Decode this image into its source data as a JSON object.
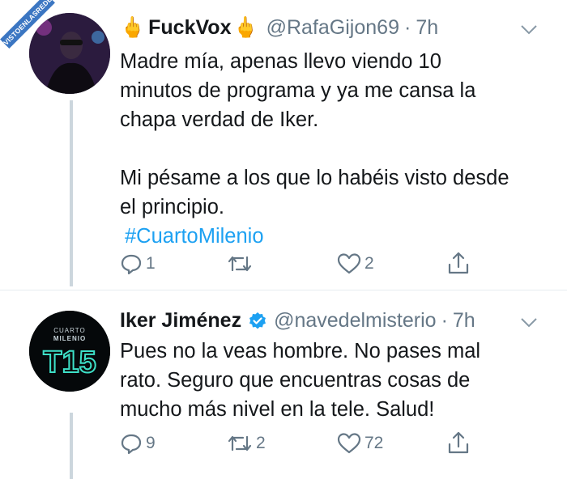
{
  "watermark": "VISTOENLASREDES",
  "tweets": [
    {
      "name": "FuckVox",
      "emoji_left": "🖕",
      "emoji_right": "🖕",
      "handle": "@RafaGijon69",
      "sep": "·",
      "time": "7h",
      "paragraphs": [
        "Madre mía, apenas llevo viendo 10 minutos de programa y ya me cansa la chapa verdad de Iker.",
        "Mi pésame a los que lo habéis visto desde el principio."
      ],
      "hashtag": "#CuartoMilenio",
      "replies": "1",
      "retweets": "",
      "likes": "2"
    },
    {
      "name": "Iker Jiménez",
      "verified": true,
      "handle": "@navedelmisterio",
      "sep": "·",
      "time": "7h",
      "paragraphs": [
        "Pues no la veas hombre. No pases mal rato. Seguro que encuentras cosas de mucho más nivel en la tele. Salud!"
      ],
      "avatar_text": {
        "top": "CUARTO",
        "middle": "MILENIO",
        "logo": "T15"
      },
      "replies": "9",
      "retweets": "2",
      "likes": "72"
    }
  ],
  "colors": {
    "accent": "#1da1f2",
    "muted": "#657786",
    "line": "#ccd6dd",
    "text": "#14171a"
  }
}
